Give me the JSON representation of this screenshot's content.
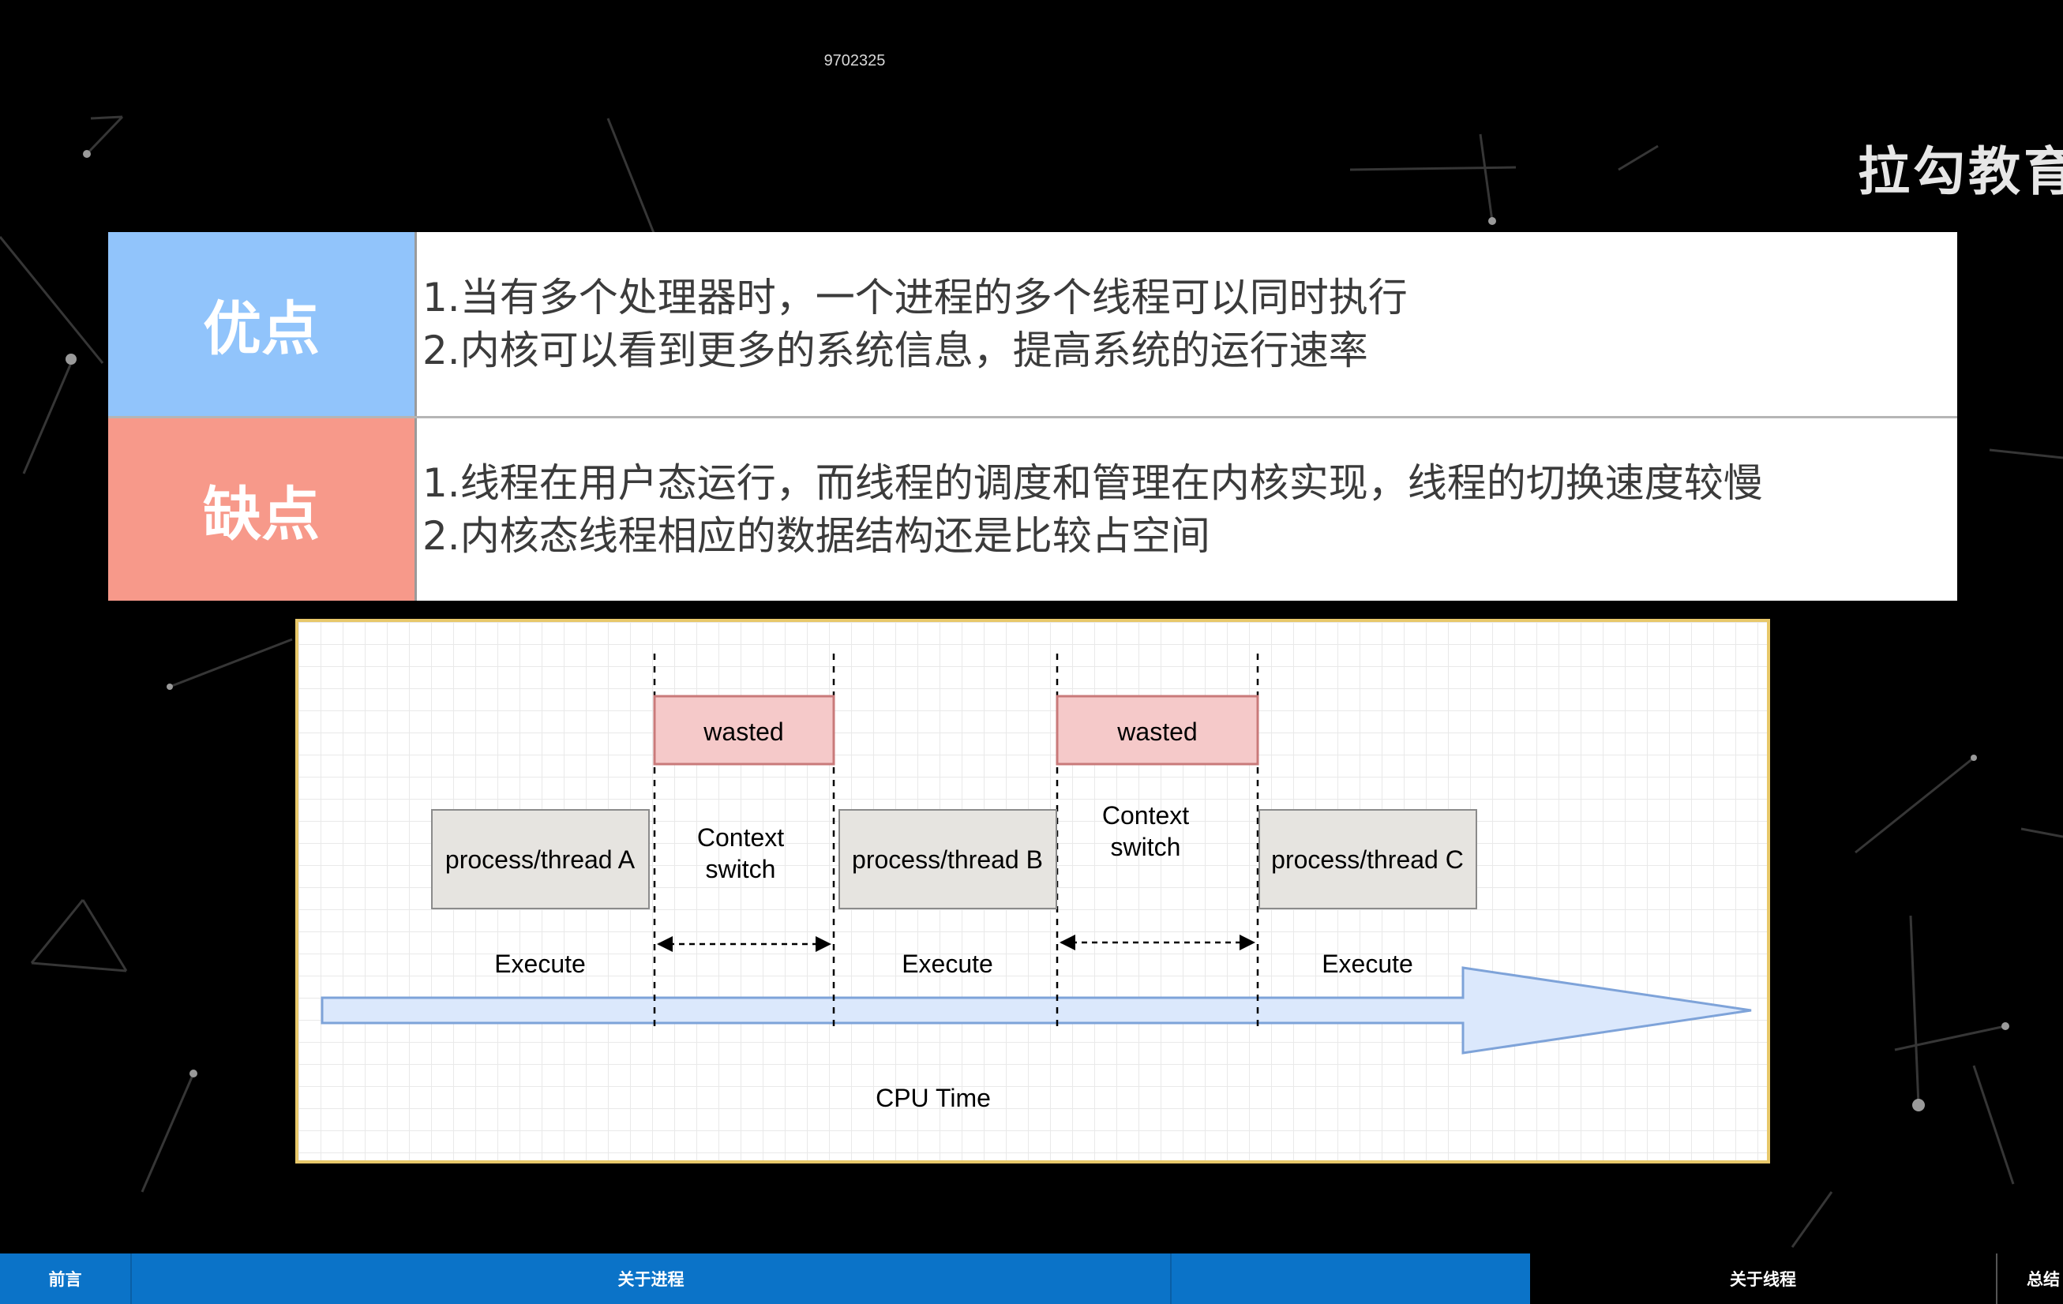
{
  "watermark": "9702325",
  "brand": "拉勾教育",
  "table": {
    "pros": {
      "label": "优点",
      "color": "#91c4fb",
      "lines": [
        "1.当有多个处理器时，一个进程的多个线程可以同时执行",
        "2.内核可以看到更多的系统信息，提高系统的运行速率"
      ]
    },
    "cons": {
      "label": "缺点",
      "color": "#f7998a",
      "lines": [
        "1.线程在用户态运行，而线程的调度和管理在内核实现，线程的切换速度较慢",
        "2.内核态线程相应的数据结构还是比较占空间"
      ]
    }
  },
  "diagram": {
    "processes": [
      "process/thread A",
      "process/thread B",
      "process/thread C"
    ],
    "execute_label": "Execute",
    "wasted_label": "wasted",
    "context_switch_line1": "Context",
    "context_switch_line2": "switch",
    "axis_label": "CPU Time"
  },
  "nav": {
    "items": [
      {
        "label": "前言",
        "active": false
      },
      {
        "label": "关于进程",
        "active": false
      },
      {
        "label": "关于线程",
        "active": true
      },
      {
        "label": "总结",
        "active": false
      }
    ]
  }
}
